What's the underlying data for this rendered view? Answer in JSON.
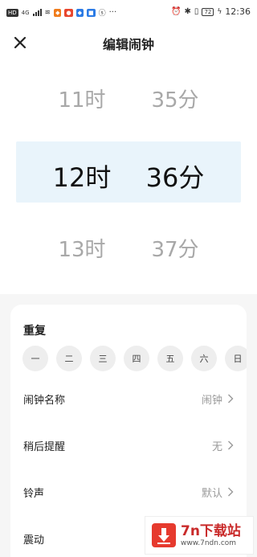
{
  "status_bar": {
    "hd": "HD",
    "network": "4G",
    "battery": "72",
    "time": "12:36",
    "more": "···"
  },
  "header": {
    "title": "编辑闹钟"
  },
  "picker": {
    "prev": {
      "hour": "11时",
      "minute": "35分"
    },
    "selected": {
      "hour": "12时",
      "minute": "36分"
    },
    "next": {
      "hour": "13时",
      "minute": "37分"
    }
  },
  "repeat": {
    "title": "重复",
    "days": [
      "一",
      "二",
      "三",
      "四",
      "五",
      "六",
      "日"
    ]
  },
  "settings": {
    "name": {
      "label": "闹钟名称",
      "value": "闹钟"
    },
    "snooze": {
      "label": "稍后提醒",
      "value": "无"
    },
    "ringtone": {
      "label": "铃声",
      "value": "默认"
    },
    "vibrate": {
      "label": "震动"
    }
  },
  "watermark": {
    "main": "7n下载站",
    "url": "www.7ndn.com"
  }
}
